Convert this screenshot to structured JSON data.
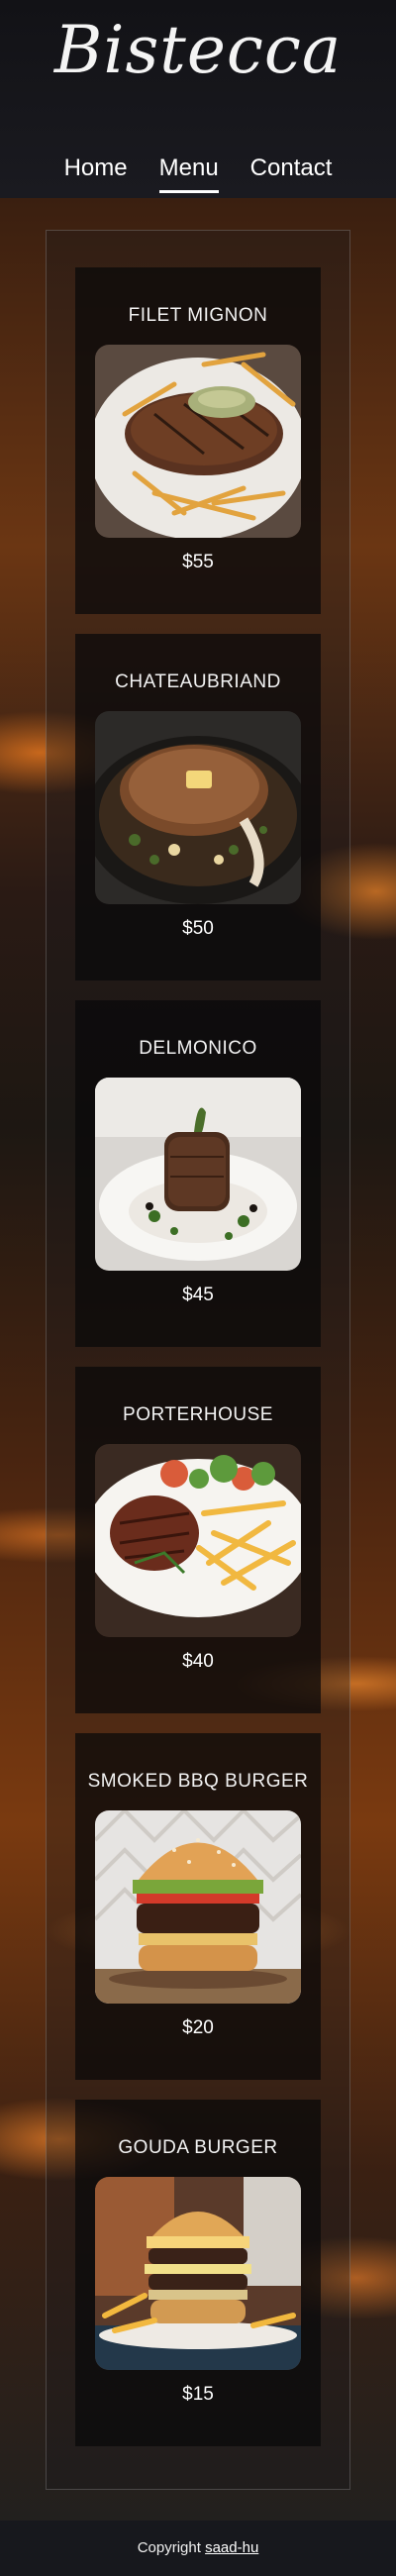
{
  "brand": {
    "name": "Bistecca"
  },
  "nav": {
    "items": [
      {
        "label": "Home",
        "active": false
      },
      {
        "label": "Menu",
        "active": true
      },
      {
        "label": "Contact",
        "active": false
      }
    ]
  },
  "menu": {
    "items": [
      {
        "name": "FILET MIGNON",
        "price": "$55",
        "image": "filet-mignon-with-fries"
      },
      {
        "name": "CHATEAUBRIAND",
        "price": "$50",
        "image": "chateaubriand-in-skillet"
      },
      {
        "name": "DELMONICO",
        "price": "$45",
        "image": "delmonico-plated"
      },
      {
        "name": "PORTERHOUSE",
        "price": "$40",
        "image": "porterhouse-with-fries"
      },
      {
        "name": "SMOKED BBQ BURGER",
        "price": "$20",
        "image": "bbq-burger"
      },
      {
        "name": "GOUDA BURGER",
        "price": "$15",
        "image": "gouda-burger-with-fries"
      }
    ]
  },
  "footer": {
    "text": "Copyright",
    "link_label": "saad-hu"
  },
  "colors": {
    "background": "#15161b",
    "card": "#0a0a0c",
    "accent": "#d9772a",
    "text": "#ffffff"
  }
}
